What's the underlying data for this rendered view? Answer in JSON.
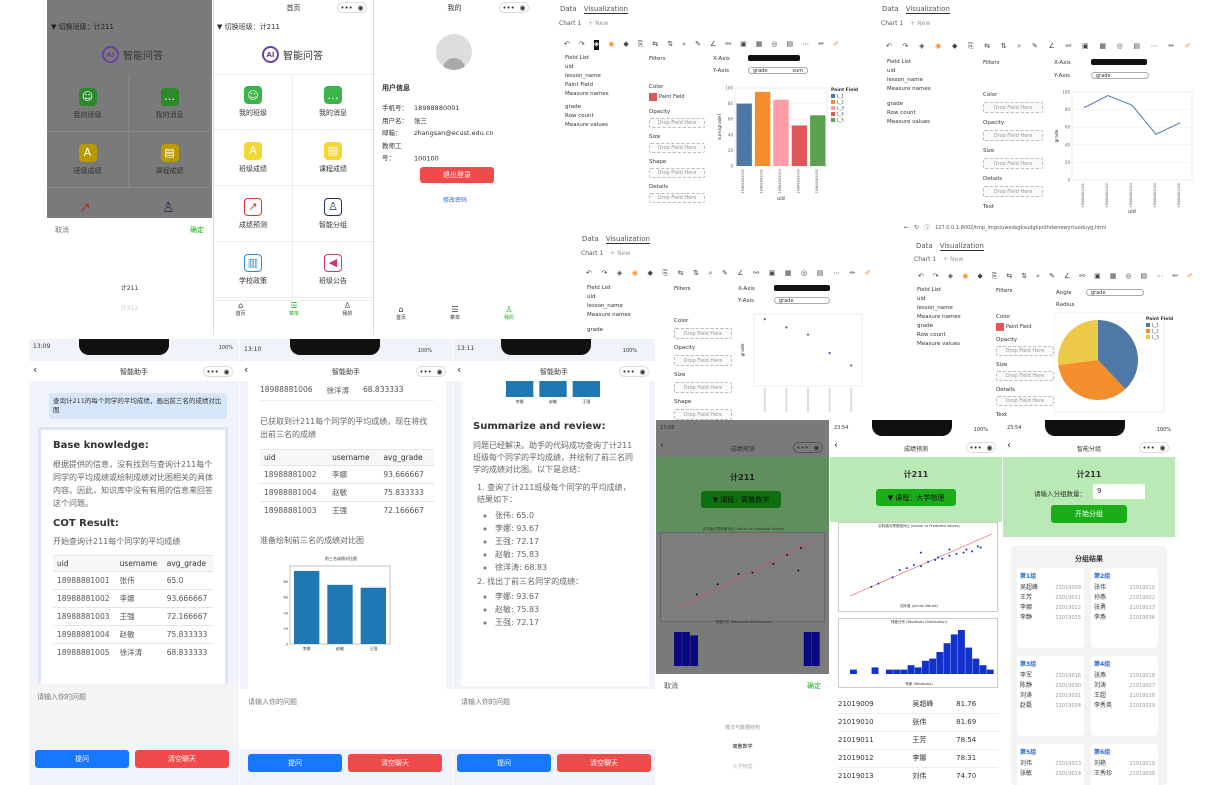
{
  "colors": {
    "green": "#1aad19",
    "red": "#f04a4a",
    "blue": "#1677ff",
    "gray": "#777777",
    "lightgreen": "#b9eab6",
    "darkblue": "#1133cc"
  },
  "s1": {
    "title": "▼ 切换班级：计211",
    "app": "智能问答",
    "tiles": [
      "我的班级",
      "我的消息",
      "班级成绩",
      "课程成绩"
    ],
    "cancel": "取消",
    "confirm": "确定",
    "picker": "计211",
    "picker2": "计212"
  },
  "s2": {
    "hdr": "首页",
    "class": "▼ 切换班级：计211",
    "app": "智能问答",
    "tiles": [
      "我的班级",
      "我的消息",
      "班级成绩",
      "课程成绩",
      "成绩预测",
      "智能分组",
      "学校政策",
      "班级公告"
    ],
    "nav": [
      "首页",
      "菜单",
      "我的"
    ]
  },
  "s3": {
    "hdr": "我的",
    "info": "用户信息",
    "fields": [
      {
        "k": "手机号：",
        "v": "18988880001"
      },
      {
        "k": "用户名：",
        "v": "张三"
      },
      {
        "k": "邮箱：",
        "v": "zhangsan@ecust.edu.cn"
      },
      {
        "k": "教师工号：",
        "v": "100100"
      }
    ],
    "btn": "退出登录",
    "link": "修改密码",
    "nav": [
      "首页",
      "菜单",
      "我的"
    ]
  },
  "viz": {
    "tabs": [
      "Data",
      "Visualization"
    ],
    "chart": "Chart 1",
    "new": "+ New",
    "fieldlist": "Field List",
    "filters": "Filters",
    "fields": [
      "uid",
      "lesson_name",
      "Paint Field",
      "Measure names"
    ],
    "fields2": [
      "uid",
      "lesson_name",
      "Measure names"
    ],
    "measures": [
      "grade",
      "Row count",
      "Measure values"
    ],
    "color": "Color",
    "opacity": "Opacity",
    "size": "Size",
    "shape": "Shape",
    "details": "Details",
    "text": "Text",
    "drop": "Drop Field Here",
    "xaxis": "X-Axis",
    "yaxis": "Y-Axis",
    "angle": "Angle",
    "radius": "Radius",
    "uid": "uid",
    "grade": "grade",
    "sum": "sum",
    "paint": "Paint Field",
    "url": "127.0.0.1:8002/tmp_imgs/uwedsgksudgkpnthdwnewyrtuoduyg.html"
  },
  "bar_chart": {
    "type": "bar",
    "legend": "Paint Field",
    "items": [
      "L_1",
      "L_2",
      "L_3",
      "L_4",
      "L_5"
    ],
    "categories": [
      "18988881001",
      "18988881002",
      "18988881003",
      "18988881004",
      "18988881005"
    ],
    "values": [
      80,
      95,
      85,
      52,
      65
    ],
    "colors": [
      "#4e79a7",
      "#f28e2b",
      "#ff9da7",
      "#e15759",
      "#59a14f"
    ],
    "ylim": [
      0,
      100
    ],
    "xlabel": "uid",
    "ylabel": "sum(grade)"
  },
  "line_chart": {
    "type": "line",
    "categories": [
      "18988881001",
      "18988881002",
      "18988881003",
      "18988881004",
      "18988881005"
    ],
    "values": [
      82,
      96,
      85,
      52,
      65
    ],
    "ylim": [
      0,
      100
    ],
    "xlabel": "uid",
    "ylabel": "grade"
  },
  "scatter_chart": {
    "type": "scatter",
    "values": [
      95,
      87,
      80,
      62,
      50
    ],
    "ylabel": "grade"
  },
  "pie_chart": {
    "type": "pie",
    "legend": "Paint Field",
    "items": [
      "L_1",
      "L_2",
      "L_3"
    ],
    "values": [
      38,
      35,
      27
    ],
    "colors": [
      "#4e79a7",
      "#f28e2b",
      "#edc948"
    ]
  },
  "chat1": {
    "time": "13:09",
    "battery": "100%",
    "title": "智能助手",
    "q": "查询计211的每个同学的平均成绩，画出前三名的成绩对比图",
    "h1": "Base knowledge:",
    "p1": "根据提供的信息，没有找到与查询计211每个同学的平均成绩或绘制成绩对比图相关的具体内容。因此，知识库中没有有用的信息来回答这个问题。",
    "h2": "COT Result:",
    "p2": "开始查询计211每个同学的平均成绩",
    "cols": [
      "uid",
      "username",
      "avg_grade"
    ],
    "rows": [
      [
        "18988881001",
        "张伟",
        "65.0"
      ],
      [
        "18988881002",
        "李娜",
        "93.666667"
      ],
      [
        "18988881003",
        "王强",
        "72.166667"
      ],
      [
        "18988881004",
        "赵敏",
        "75.833333"
      ],
      [
        "18988881005",
        "徐洋涛",
        "68.833333"
      ]
    ],
    "input": "请输入你的问题",
    "ask": "提问",
    "clear": "清空聊天"
  },
  "chat2": {
    "time": "13:10",
    "battery": "100%",
    "title": "智能助手",
    "toprow": [
      "18988881006",
      "徐洋涛",
      "68.833333"
    ],
    "p1": "已获取到计211每个同学的平均成绩，现在将找出前三名的成绩",
    "cols": [
      "uid",
      "username",
      "avg_grade"
    ],
    "rows": [
      [
        "18988881002",
        "李娜",
        "93.666667"
      ],
      [
        "18988881004",
        "赵敏",
        "75.833333"
      ],
      [
        "18988881003",
        "王强",
        "72.166667"
      ]
    ],
    "p2": "准备绘制前三名的成绩对比图",
    "charttitle": "前三名成绩对比图",
    "bars": [
      93.67,
      75.83,
      72.17
    ],
    "barlabels": [
      "李娜",
      "赵敏",
      "王强"
    ],
    "input": "请输入你的问题",
    "ask": "提问",
    "clear": "清空聊天"
  },
  "chat3": {
    "time": "13:11",
    "battery": "100%",
    "title": "智能助手",
    "h": "Summarize and review:",
    "p": "问题已经解决。助手的代码成功查询了计211班级每个同学的平均成绩，并绘制了前三名同学的成绩对比图。以下是总结：",
    "l1": "1. 查询了计211班级每个同学的平均成绩，结果如下：",
    "list1": [
      "张伟: 65.0",
      "李娜: 93.67",
      "王强: 72.17",
      "赵敏: 75.83",
      "徐洋涛: 68.83"
    ],
    "l2": "2. 找出了前三名同学的成绩：",
    "list2": [
      "李娜: 93.67",
      "赵敏: 75.83",
      "王强: 72.17"
    ],
    "input": "请输入你的问题",
    "ask": "提问",
    "clear": "清空聊天"
  },
  "pred1": {
    "time": "17:08",
    "title": "成绩预测",
    "class": "计211",
    "course": "▼ 课程：离散数学",
    "c1": "实际值与预测值对比 (Actual vs Predicted Values)",
    "c2": "残差分布 (Residuals Distribution)",
    "cancel": "取消",
    "confirm": "确定",
    "opts": [
      "算法与数据结构",
      "离散数学",
      "大学物理"
    ]
  },
  "pred2": {
    "time": "23:54",
    "battery": "100%",
    "title": "成绩预测",
    "class": "计211",
    "course": "▼ 课程：大学物理",
    "c1": "实际值与预测值对比 (Actual vs Predicted Values)",
    "c2": "残差分布 (Residuals Distribution)",
    "xl1": "实际值 (Actual Values)",
    "yl1": "预测值 (Predicted Values)",
    "xl2": "残差 (Residuals)",
    "yl2": "频率 (Frequency)",
    "rows": [
      [
        "21019009",
        "吴超峰",
        "81.76"
      ],
      [
        "21019010",
        "张伟",
        "81.69"
      ],
      [
        "21019011",
        "王芳",
        "78.54"
      ],
      [
        "21019012",
        "李娜",
        "78.31"
      ],
      [
        "21019013",
        "刘伟",
        "74.70"
      ]
    ]
  },
  "group": {
    "time": "23:54",
    "battery": "100%",
    "title": "智能分组",
    "class": "计211",
    "label": "请输入分组数量：",
    "value": "9",
    "btn": "开始分组",
    "result": "分组结果",
    "groups": [
      {
        "h": "第1组",
        "m": [
          [
            "吴超峰",
            "21019009"
          ],
          [
            "王芳",
            "21019011"
          ],
          [
            "李娜",
            "21019012"
          ],
          [
            "李静",
            "21019015"
          ]
        ]
      },
      {
        "h": "第2组",
        "m": [
          [
            "张伟",
            "21019010"
          ],
          [
            "孙燕",
            "21019022"
          ],
          [
            "张勇",
            "21019023"
          ],
          [
            "李燕",
            "21019036"
          ]
        ]
      },
      {
        "h": "第3组",
        "m": [
          [
            "李军",
            "21019016"
          ],
          [
            "陈静",
            "21019030"
          ],
          [
            "刘涛",
            "21019031"
          ],
          [
            "赵磊",
            "21019034"
          ]
        ]
      },
      {
        "h": "第4组",
        "m": [
          [
            "张燕",
            "21019018"
          ],
          [
            "刘涛",
            "21019027"
          ],
          [
            "王超",
            "21019028"
          ],
          [
            "李秀英",
            "21019029"
          ]
        ]
      },
      {
        "h": "第5组",
        "m": [
          [
            "刘伟",
            "21019013"
          ],
          [
            "张敏",
            "21019014"
          ]
        ]
      },
      {
        "h": "第6组",
        "m": [
          [
            "刘艳",
            "21019019"
          ],
          [
            "王秀珍",
            "21019038"
          ]
        ]
      }
    ]
  }
}
